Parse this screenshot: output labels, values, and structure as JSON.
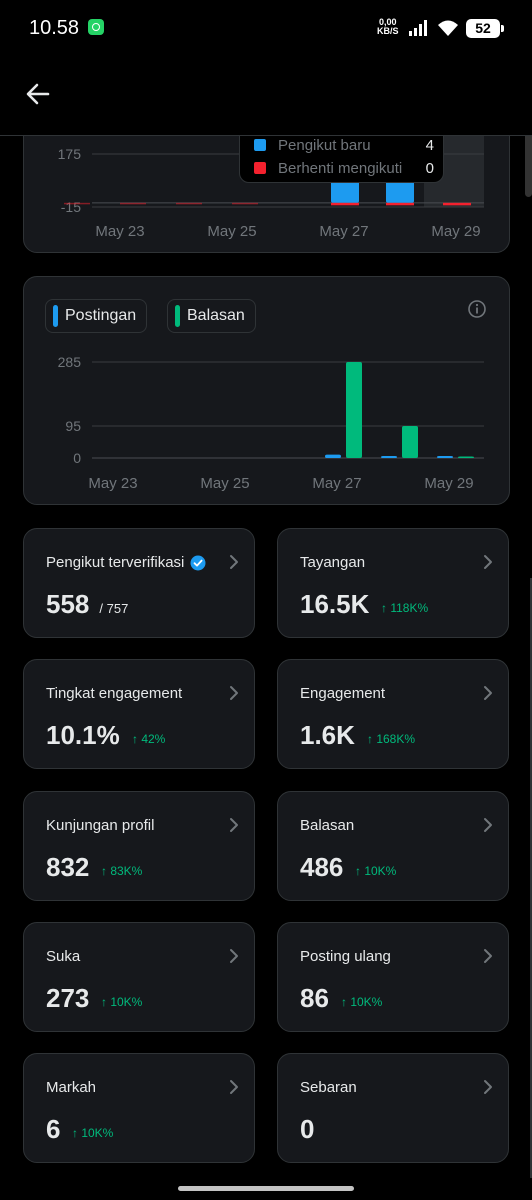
{
  "status_bar": {
    "time": "10.58",
    "net_speed_value": "0,00",
    "net_speed_unit": "KB/S",
    "battery": "52",
    "icons": [
      "whatsapp-icon",
      "signal-icon",
      "wifi-icon",
      "battery-icon"
    ]
  },
  "header": {
    "back_icon": "arrow-left-icon"
  },
  "followers_chart": {
    "y_ticks": [
      "175",
      "-15"
    ],
    "x_ticks": [
      "May 23",
      "May 25",
      "May 27",
      "May 29"
    ],
    "tooltip": {
      "rows": [
        {
          "label": "Pengikut baru",
          "value": "4",
          "color": "#1d9bf0"
        },
        {
          "label": "Berhenti mengikuti",
          "value": "0",
          "color": "#f4212e"
        }
      ]
    }
  },
  "posts_chart": {
    "legend": [
      {
        "label": "Postingan",
        "color": "#1d9bf0"
      },
      {
        "label": "Balasan",
        "color": "#00ba7c"
      }
    ],
    "info_icon": "info-icon",
    "y_ticks": [
      "285",
      "95",
      "0"
    ],
    "x_ticks": [
      "May 23",
      "May 25",
      "May 27",
      "May 29"
    ]
  },
  "chart_data": [
    {
      "type": "bar",
      "categories": [
        "May 23",
        "May 24",
        "May 25",
        "May 26",
        "May 27",
        "May 28",
        "May 29"
      ],
      "series": [
        {
          "name": "Pengikut baru",
          "values": [
            0,
            0,
            0,
            0,
            4,
            4,
            0
          ]
        },
        {
          "name": "Berhenti mengikuti",
          "values": [
            0,
            0,
            0,
            0,
            0,
            0,
            0
          ]
        }
      ],
      "ylim": [
        -15,
        175
      ],
      "grid": true
    },
    {
      "type": "bar",
      "categories": [
        "May 23",
        "May 24",
        "May 25",
        "May 26",
        "May 27",
        "May 28",
        "May 29"
      ],
      "series": [
        {
          "name": "Postingan",
          "values": [
            0,
            0,
            0,
            0,
            10,
            6,
            1
          ]
        },
        {
          "name": "Balasan",
          "values": [
            0,
            0,
            0,
            0,
            290,
            95,
            1
          ]
        }
      ],
      "ylim": [
        0,
        285
      ],
      "grid": true
    }
  ],
  "metrics": [
    {
      "title": "Pengikut terverifikasi",
      "value": "558",
      "sub": "/ 757",
      "change": "",
      "verified": true
    },
    {
      "title": "Tayangan",
      "value": "16.5K",
      "sub": "",
      "change": "↑ 118K%"
    },
    {
      "title": "Tingkat engagement",
      "value": "10.1%",
      "sub": "",
      "change": "↑ 42%"
    },
    {
      "title": "Engagement",
      "value": "1.6K",
      "sub": "",
      "change": "↑ 168K%"
    },
    {
      "title": "Kunjungan profil",
      "value": "832",
      "sub": "",
      "change": "↑ 83K%"
    },
    {
      "title": "Balasan",
      "value": "486",
      "sub": "",
      "change": "↑ 10K%"
    },
    {
      "title": "Suka",
      "value": "273",
      "sub": "",
      "change": "↑ 10K%"
    },
    {
      "title": "Posting ulang",
      "value": "86",
      "sub": "",
      "change": "↑ 10K%"
    },
    {
      "title": "Markah",
      "value": "6",
      "sub": "",
      "change": "↑ 10K%"
    },
    {
      "title": "Sebaran",
      "value": "0",
      "sub": "",
      "change": ""
    }
  ]
}
